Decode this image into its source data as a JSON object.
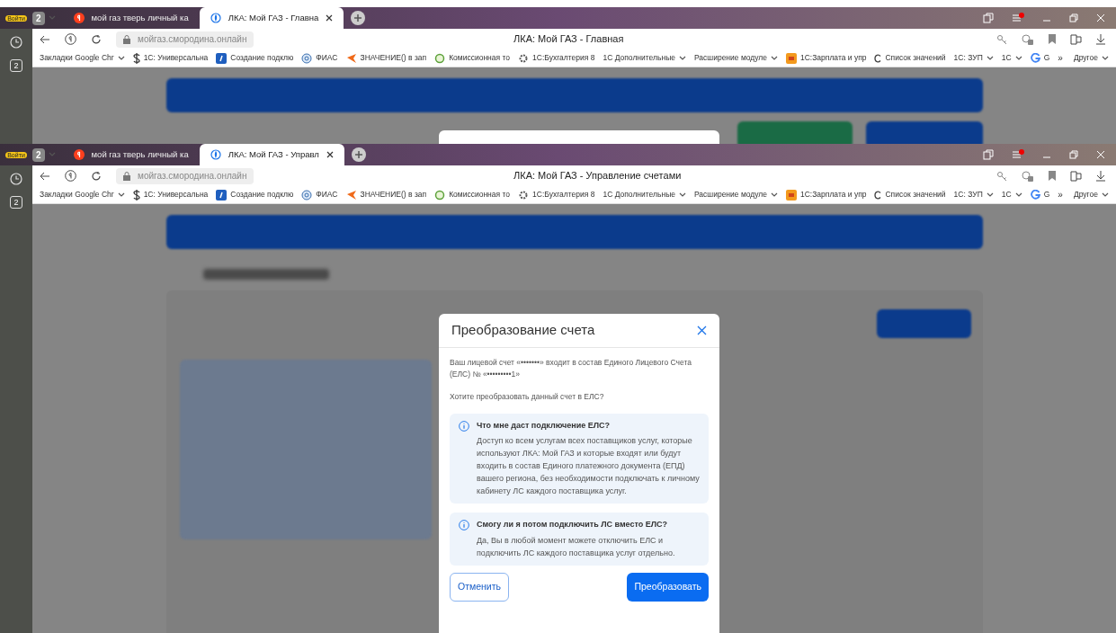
{
  "windows": [
    {
      "profile_label": "Войти",
      "tab_count": "2",
      "tabs": [
        {
          "title": "мой газ тверь личный ка",
          "selected": false,
          "kind": "yandex"
        },
        {
          "title": "ЛКА: Мой ГАЗ - Главна",
          "selected": true,
          "kind": "site"
        }
      ],
      "address": "мойгаз.смородина.онлайн",
      "page_title": "ЛКА: Мой ГАЗ - Главная",
      "sidebar_badge": "2",
      "bookmarks": [
        {
          "label": "Закладки Google Chr",
          "kind": "plain",
          "dropdown": true
        },
        {
          "label": "1С: Универсальна",
          "kind": "dollar",
          "dropdown": false
        },
        {
          "label": "Создание подклю",
          "kind": "document",
          "dropdown": false
        },
        {
          "label": "ФИАС",
          "kind": "globe",
          "dropdown": false
        },
        {
          "label": "ЗНАЧЕНИЕ() в зап",
          "kind": "flag",
          "dropdown": false
        },
        {
          "label": "Комиссионная то",
          "kind": "ring",
          "dropdown": false
        },
        {
          "label": "1С:Бухгалтерия 8",
          "kind": "gear",
          "dropdown": false
        },
        {
          "label": "1С Дополнительные",
          "kind": "plain",
          "dropdown": true
        },
        {
          "label": "Расширение модуле",
          "kind": "plain",
          "dropdown": true
        },
        {
          "label": "1С:Зарплата и упр",
          "kind": "app",
          "dropdown": false
        },
        {
          "label": "Список значений",
          "kind": "letter",
          "dropdown": false
        },
        {
          "label": "1С: ЗУП",
          "kind": "plain",
          "dropdown": true
        },
        {
          "label": "1С",
          "kind": "plain",
          "dropdown": true
        },
        {
          "label": "G",
          "kind": "google",
          "dropdown": false
        }
      ],
      "bookmarks_overflow": "»",
      "other_bookmarks": "Другое"
    },
    {
      "profile_label": "Войти",
      "tab_count": "2",
      "tabs": [
        {
          "title": "мой газ тверь личный ка",
          "selected": false,
          "kind": "yandex"
        },
        {
          "title": "ЛКА: Мой ГАЗ - Управл",
          "selected": true,
          "kind": "site"
        }
      ],
      "address": "мойгаз.смородина.онлайн",
      "page_title": "ЛКА: Мой ГАЗ - Управление счетами",
      "sidebar_badge": "2",
      "bookmarks": [
        {
          "label": "Закладки Google Chr",
          "kind": "plain",
          "dropdown": true
        },
        {
          "label": "1С: Универсальна",
          "kind": "dollar",
          "dropdown": false
        },
        {
          "label": "Создание подклю",
          "kind": "document",
          "dropdown": false
        },
        {
          "label": "ФИАС",
          "kind": "globe",
          "dropdown": false
        },
        {
          "label": "ЗНАЧЕНИЕ() в зап",
          "kind": "flag",
          "dropdown": false
        },
        {
          "label": "Комиссионная то",
          "kind": "ring",
          "dropdown": false
        },
        {
          "label": "1С:Бухгалтерия 8",
          "kind": "gear",
          "dropdown": false
        },
        {
          "label": "1С Дополнительные",
          "kind": "plain",
          "dropdown": true
        },
        {
          "label": "Расширение модуле",
          "kind": "plain",
          "dropdown": true
        },
        {
          "label": "1С:Зарплата и упр",
          "kind": "app",
          "dropdown": false
        },
        {
          "label": "Список значений",
          "kind": "letter",
          "dropdown": false
        },
        {
          "label": "1С: ЗУП",
          "kind": "plain",
          "dropdown": true
        },
        {
          "label": "1С",
          "kind": "plain",
          "dropdown": true
        },
        {
          "label": "G",
          "kind": "google",
          "dropdown": false
        }
      ],
      "bookmarks_overflow": "»",
      "other_bookmarks": "Другое"
    }
  ],
  "modal": {
    "title": "Преобразование счета",
    "message": "Ваш лицевой счет «•••••••» входит в состав Единого Лицевого Счета (ЕЛС) № «•••••••••1»",
    "question": "Хотите преобразовать данный счет в ЕЛС?",
    "info": [
      {
        "title": "Что мне даст подключение ЕЛС?",
        "text": "Доступ ко всем услугам всех поставщиков услуг, которые используют ЛКА: Мой ГАЗ и которые входят или будут входить в состав Единого платежного документа (ЕПД) вашего региона, без необходимости подключать к личному кабинету ЛС каждого поставщика услуг."
      },
      {
        "title": "Смогу ли я потом подключить ЛС вместо ЕЛС?",
        "text": "Да, Вы в любой момент можете отключить ЕЛС и подключить ЛС каждого поставщика услуг отдельно."
      }
    ],
    "buttons": [
      {
        "label": "Отменить",
        "kind": "secondary"
      },
      {
        "label": "Преобразовать",
        "kind": "primary"
      }
    ]
  }
}
